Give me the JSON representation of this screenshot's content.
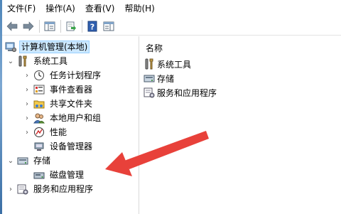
{
  "menu": {
    "file": "文件(F)",
    "action": "操作(A)",
    "view": "查看(V)",
    "help": "帮助(H)"
  },
  "tree": {
    "root": "计算机管理(本地)",
    "system_tools": "系统工具",
    "task_scheduler": "任务计划程序",
    "event_viewer": "事件查看器",
    "shared_folders": "共享文件夹",
    "local_users": "本地用户和组",
    "performance": "性能",
    "device_manager": "设备管理器",
    "storage": "存储",
    "disk_management": "磁盘管理",
    "services_apps": "服务和应用程序"
  },
  "list": {
    "header": "名称",
    "items": [
      "系统工具",
      "存储",
      "服务和应用程序"
    ]
  },
  "colors": {
    "annotation_arrow": "#e8413a",
    "selection": "#cce8ff"
  }
}
